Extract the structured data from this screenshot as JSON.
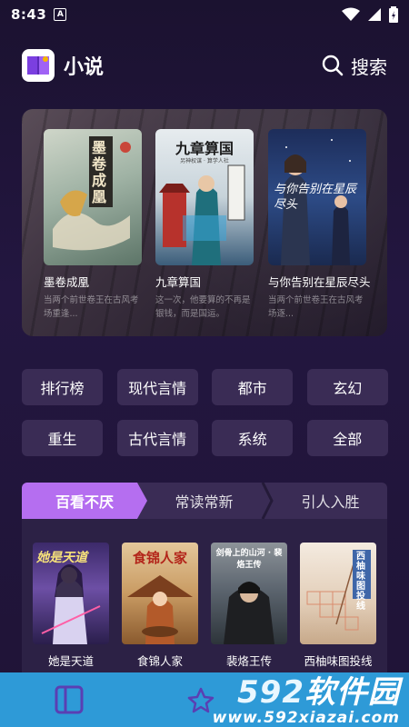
{
  "status_bar": {
    "time": "8:43",
    "badge": "A"
  },
  "header": {
    "app_title": "小说",
    "search_label": "搜索"
  },
  "featured": [
    {
      "title": "墨卷成凰",
      "desc": "当两个前世卷王在古风考场重逢...",
      "cover_text": "墨卷成凰"
    },
    {
      "title": "九章算国",
      "desc": "这一次，他要算的不再是银钱，而是国运。",
      "cover_text": "九章算国",
      "cover_sub": "另神权谋 · 算学人社"
    },
    {
      "title": "与你告别在星辰尽头",
      "desc": "当两个前世卷王在古风考场逐...",
      "cover_text": "与你告别在星辰尽头"
    }
  ],
  "categories": [
    "排行榜",
    "现代言情",
    "都市",
    "玄幻",
    "重生",
    "古代言情",
    "系统",
    "全部"
  ],
  "tabs": [
    "百看不厌",
    "常读常新",
    "引人入胜"
  ],
  "books": [
    {
      "title": "她是天道",
      "cover_text": "她是天道"
    },
    {
      "title": "食锦人家",
      "cover_text": "食锦人家"
    },
    {
      "title": "裴烙王传",
      "cover_text": "剑骨上的山河 · 裴烙王传"
    },
    {
      "title": "西柚味图投线",
      "cover_text": "西柚味图投线"
    }
  ],
  "watermark": {
    "big_num": "592",
    "big_text": "软件园",
    "url": "www.592xiazai.com"
  },
  "colors": {
    "accent": "#b56ef0",
    "button_bg": "#3a2c55",
    "nav_bg": "#2e9ad7"
  }
}
